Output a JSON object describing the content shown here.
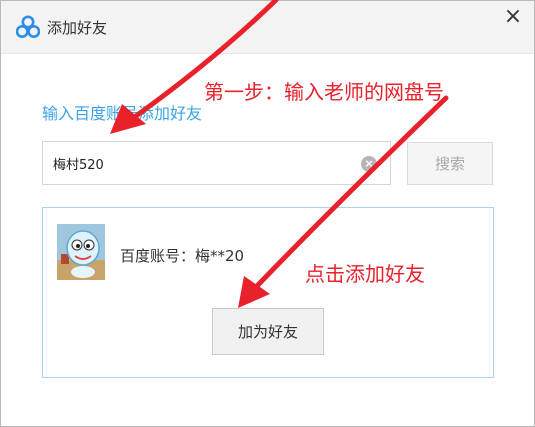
{
  "window": {
    "title": "添加好友",
    "close_glyph": "×"
  },
  "form": {
    "instruction": "输入百度账号添加好友",
    "search_value": "梅村520",
    "clear_glyph": "×",
    "search_button": "搜索"
  },
  "result": {
    "account_label": "百度账号：梅**20",
    "add_button": "加为好友"
  },
  "annotations": {
    "step1": "第一步：输入老师的网盘号",
    "step2": "点击添加好友",
    "arrow_color": "#e8212b"
  }
}
